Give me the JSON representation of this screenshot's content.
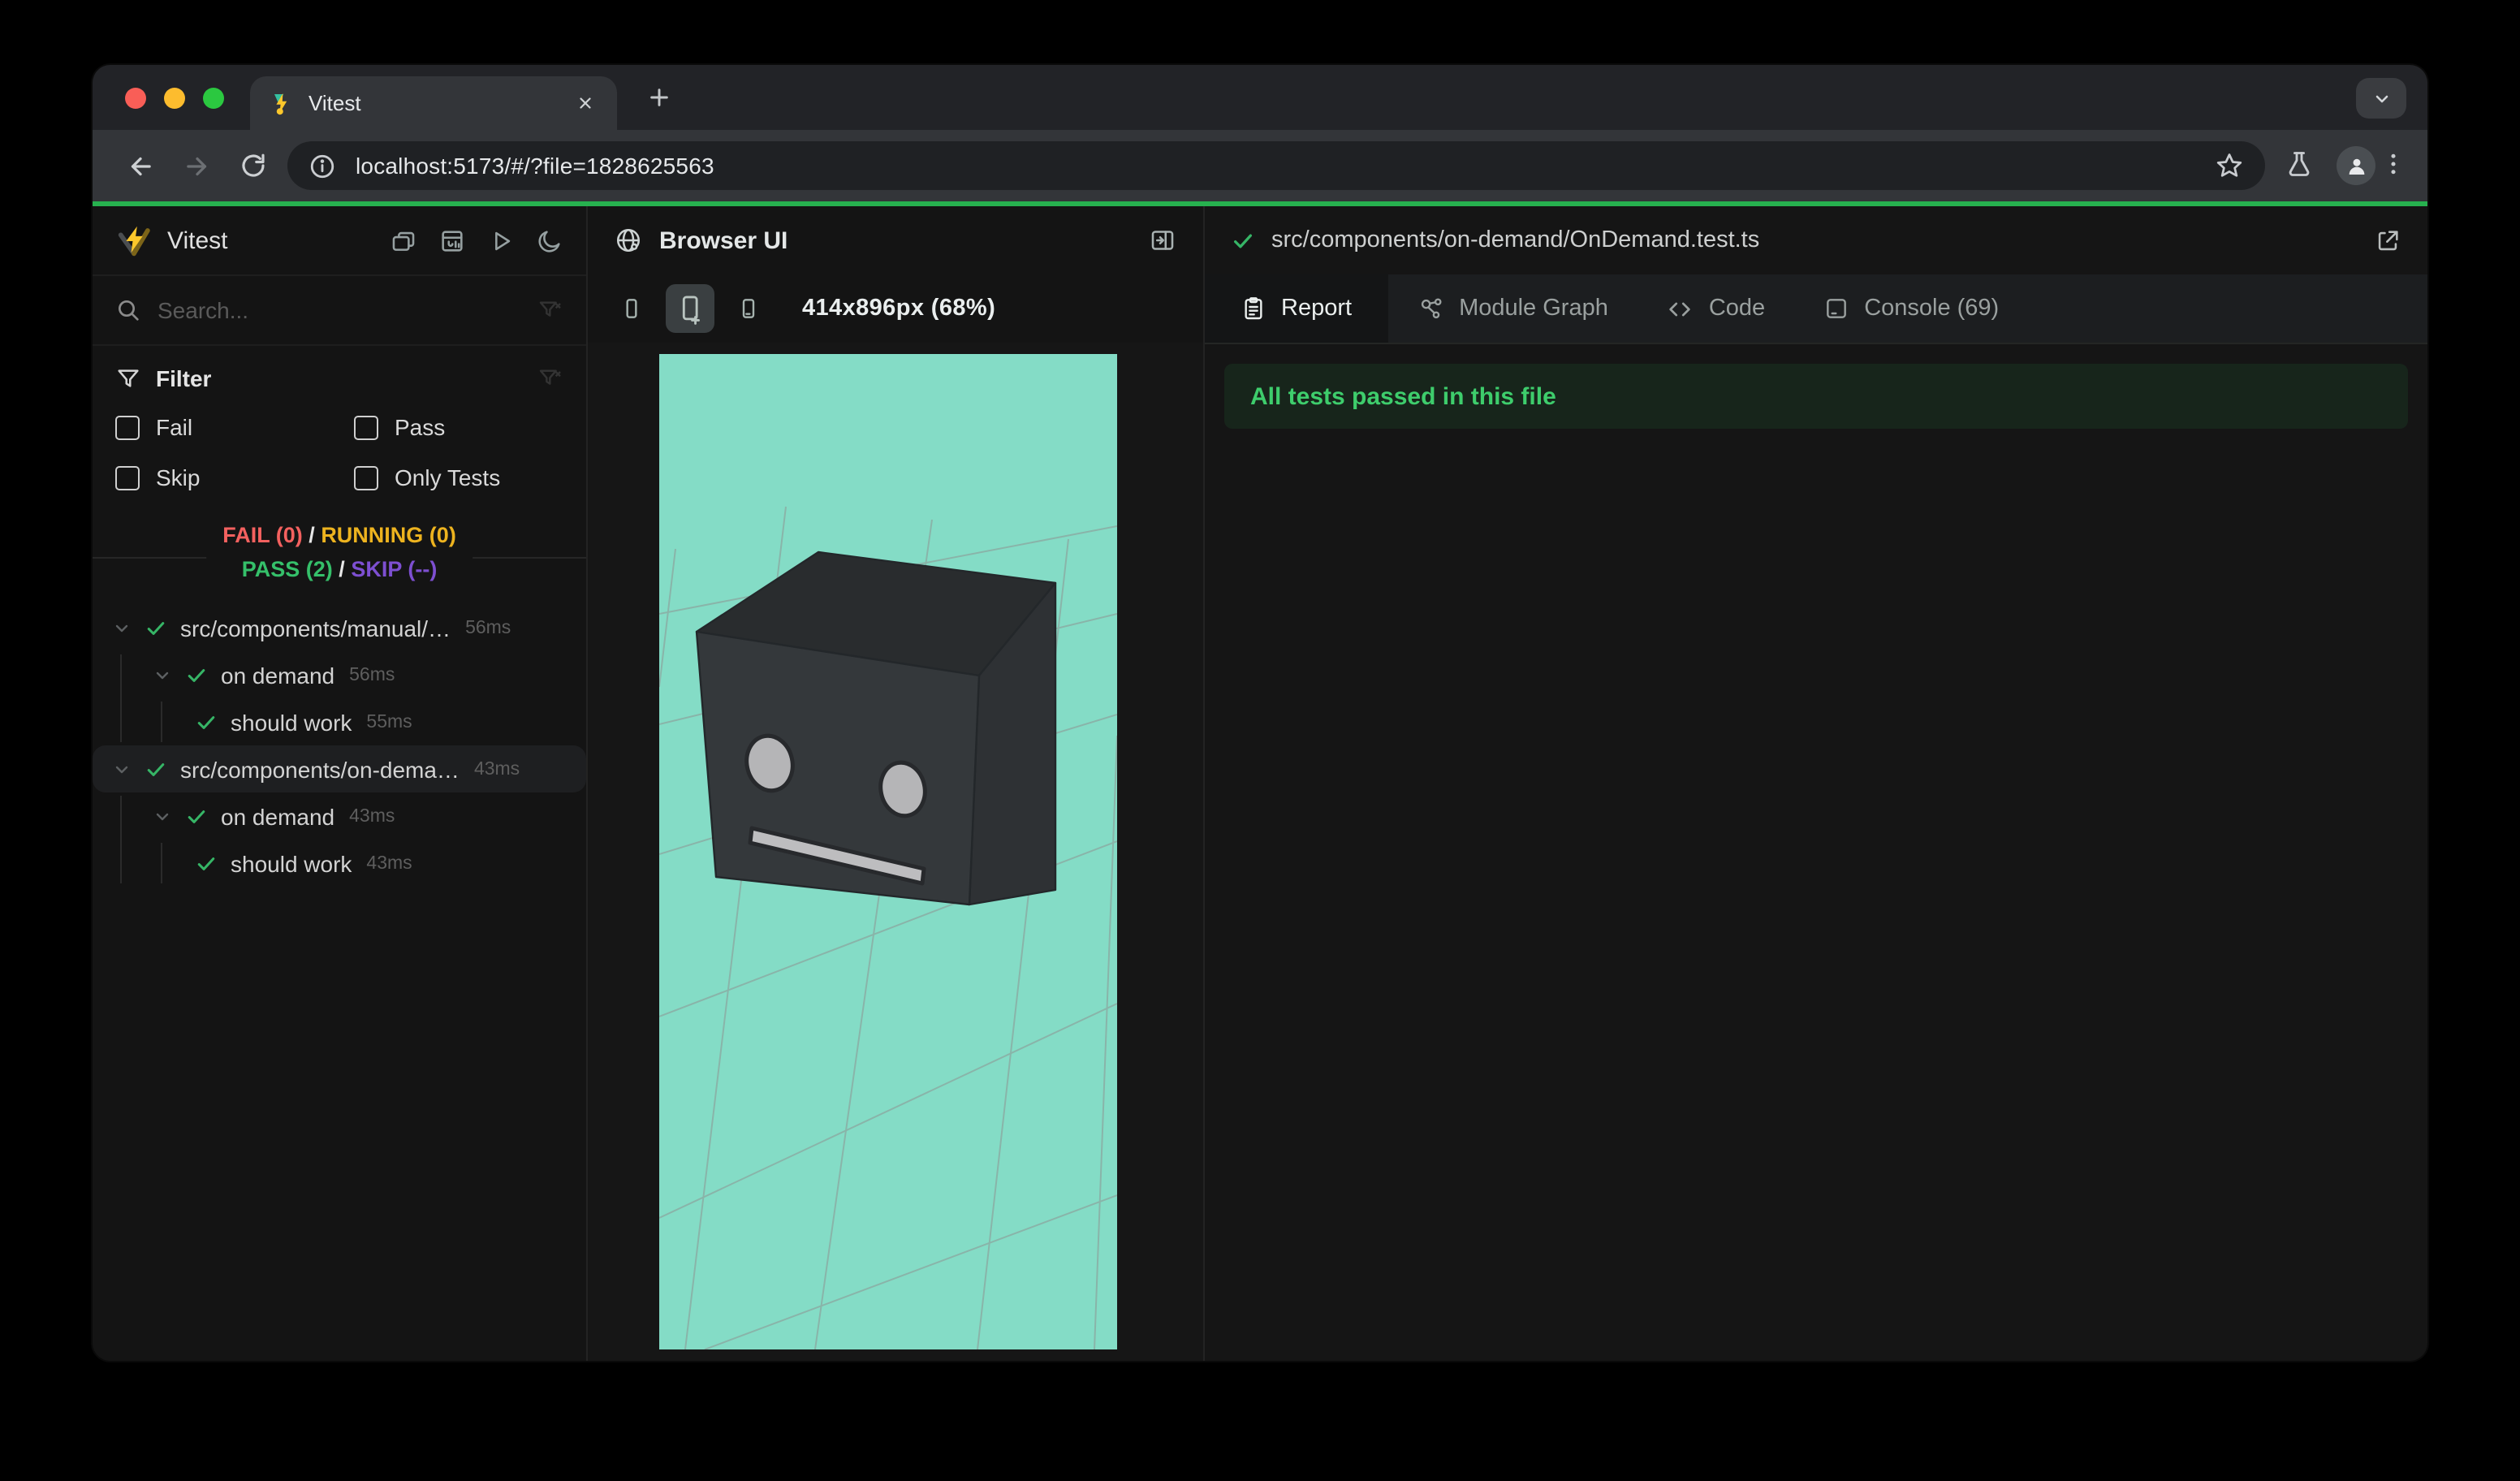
{
  "browser": {
    "tab_title": "Vitest",
    "url": "localhost:5173/#/?file=1828625563"
  },
  "sidebar": {
    "app_title": "Vitest",
    "search_placeholder": "Search...",
    "filter": {
      "title": "Filter",
      "options": [
        "Fail",
        "Pass",
        "Skip",
        "Only Tests"
      ]
    },
    "summary": {
      "fail": "FAIL (0)",
      "running": "RUNNING (0)",
      "pass": "PASS (2)",
      "skip": "SKIP (--)",
      "sep": "/"
    },
    "tree": [
      {
        "label": "src/components/manual/…",
        "time": "56ms"
      },
      {
        "label": "on demand",
        "time": "56ms"
      },
      {
        "label": "should work",
        "time": "55ms"
      },
      {
        "label": "src/components/on-dema…",
        "time": "43ms"
      },
      {
        "label": "on demand",
        "time": "43ms"
      },
      {
        "label": "should work",
        "time": "43ms"
      }
    ]
  },
  "preview": {
    "title": "Browser UI",
    "size_label": "414x896px (68%)"
  },
  "report": {
    "file_path": "src/components/on-demand/OnDemand.test.ts",
    "tabs": [
      {
        "label": "Report"
      },
      {
        "label": "Module Graph"
      },
      {
        "label": "Code"
      },
      {
        "label": "Console (69)"
      }
    ],
    "banner": "All tests passed in this file"
  },
  "colors": {
    "progress_green": "#27b14f",
    "pass_green": "#35c06a",
    "fail_red": "#f4615f",
    "running_amber": "#edb31f",
    "skip_purple": "#7d4fd1",
    "banner_bg": "#17251b",
    "banner_text": "#3ecd6c",
    "viewport_mint": "#84dcc6",
    "traffic_red": "#f95e57",
    "traffic_yellow": "#fdbc2e",
    "traffic_green": "#2bc840"
  }
}
